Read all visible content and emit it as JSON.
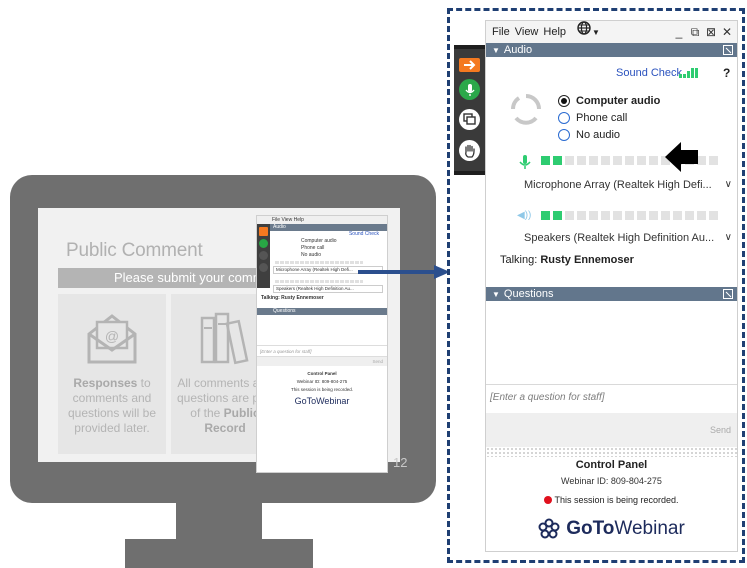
{
  "slide": {
    "title": "Public Comment",
    "banner": "Please submit your comments",
    "card_left": {
      "bold": "Responses",
      "text": " to comments and questions will be provided later."
    },
    "card_right": {
      "text": "All comments and questions are part of the",
      "bold": "Public Record"
    },
    "page_number": "12"
  },
  "mini_panel": {
    "menu": "File  View  Help",
    "audio_header": "Audio",
    "sound_check": "Sound Check",
    "options": [
      "Computer audio",
      "Phone call",
      "No audio"
    ],
    "mic_select": "Microphone Array (Realtek High Defi...",
    "speaker_select": "Speakers (Realtek High Definition Au...",
    "talking": "Talking: Rusty Ennemoser",
    "questions_header": "Questions",
    "question_placeholder": "[Enter a question for staff]",
    "send": "Send",
    "cp_title": "Control Panel",
    "webinar_id": "Webinar ID: 809-804-275",
    "recording": "This session is being recorded.",
    "logo": "GoToWebinar"
  },
  "panel": {
    "menu": {
      "file": "File",
      "view": "View",
      "help": "Help"
    },
    "window_controls": {
      "minimize": "_",
      "restore": "⧉",
      "popout": "⊠",
      "close": "✕"
    },
    "audio_header": "Audio",
    "sound_check": "Sound Check",
    "help_symbol": "?",
    "audio_options": [
      {
        "label": "Computer audio",
        "selected": true
      },
      {
        "label": "Phone call",
        "selected": false
      },
      {
        "label": "No audio",
        "selected": false
      }
    ],
    "mic_level_fraction": 0.1,
    "speaker_level_fraction": 0.1,
    "mic_select": "Microphone Array (Realtek High Defi...",
    "speaker_select": "Speakers (Realtek High Definition Au...",
    "talking_label": "Talking:",
    "talking_name": "Rusty Ennemoser",
    "questions_header": "Questions",
    "question_placeholder": "[Enter a question for staff]",
    "send_label": "Send",
    "cp_title": "Control Panel",
    "webinar_id": "Webinar ID: 809-804-275",
    "recording_notice": "This session is being recorded.",
    "logo_goto": "GoTo",
    "logo_webinar": "Webinar"
  },
  "colors": {
    "section_bar": "#62768c",
    "accent_orange": "#f47920",
    "accent_green": "#2ba84a",
    "level_green": "#2ecc71",
    "dashed_frame": "#1f3f73",
    "arrow_blue": "#2b4f8e",
    "recording_red": "#e0101d"
  },
  "icons": [
    "arrow-right-icon",
    "microphone-icon",
    "screen-share-icon",
    "raise-hand-icon",
    "globe-icon",
    "speaker-icon",
    "spinner-icon",
    "gotowebinar-logo-icon",
    "envelope-icon",
    "books-icon"
  ]
}
